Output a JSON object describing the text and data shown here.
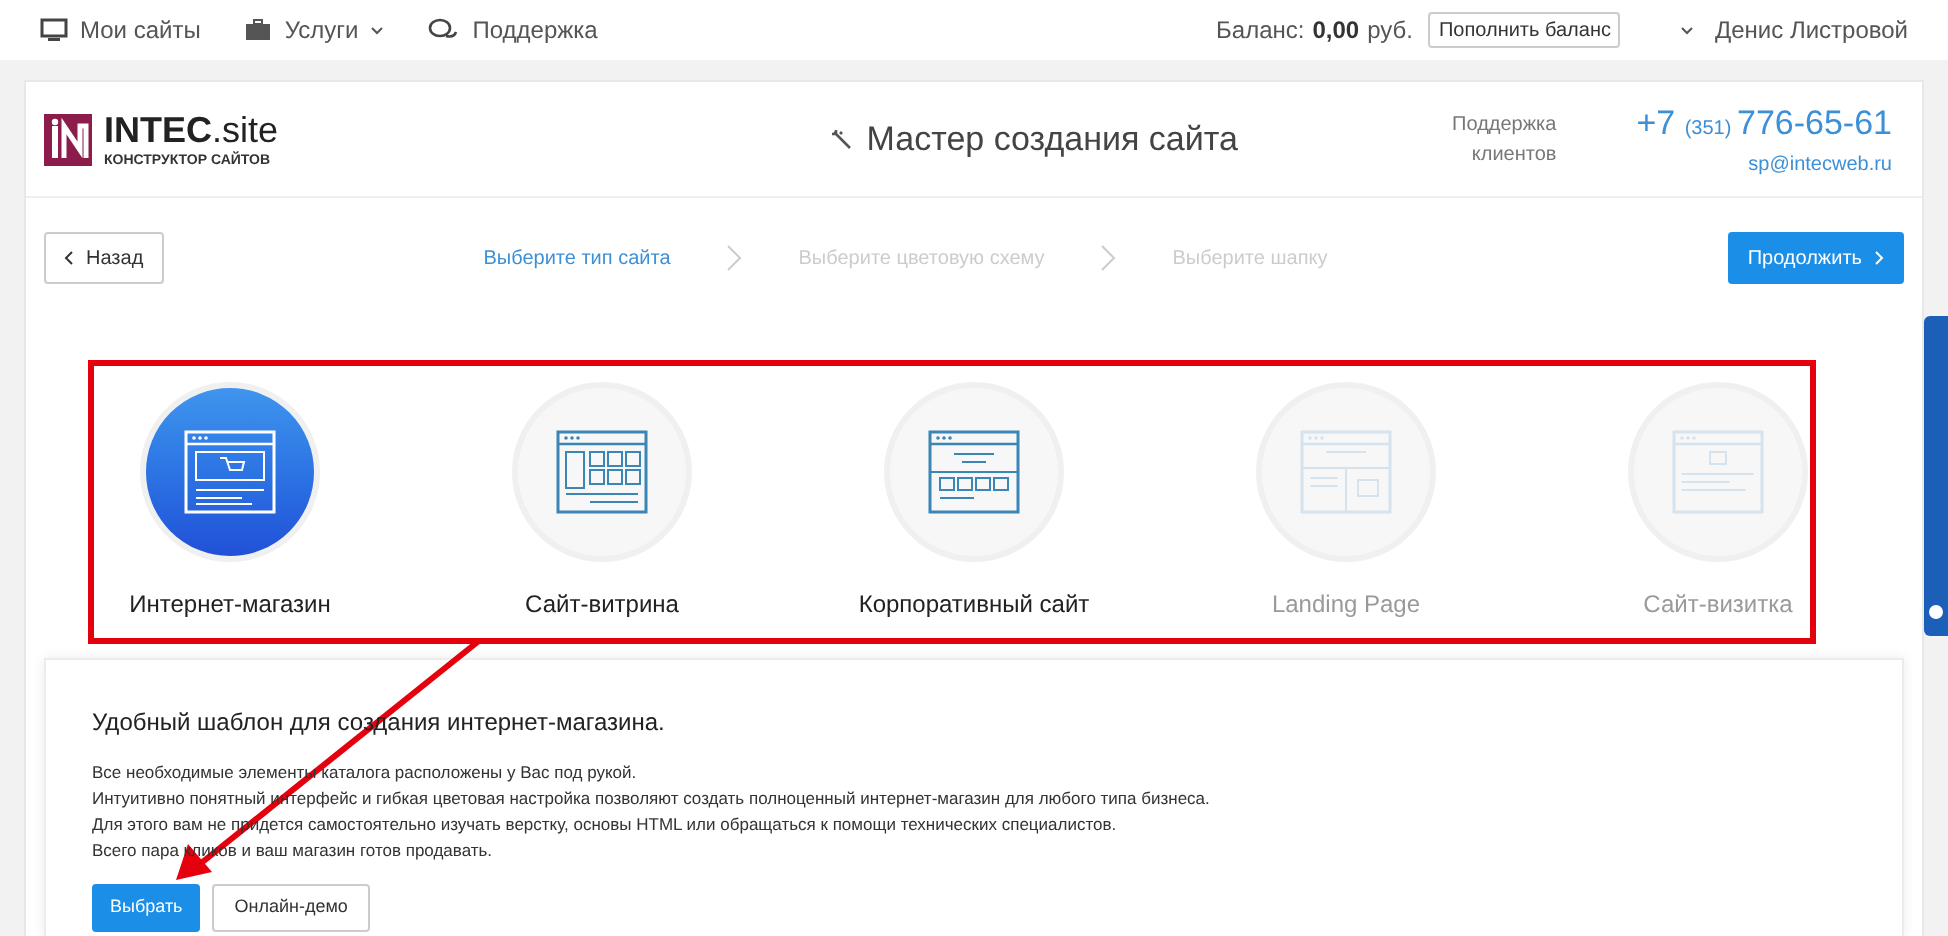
{
  "top_bar": {
    "nav": [
      {
        "label": "Мои сайты",
        "kind": "monitor"
      },
      {
        "label": "Услуги",
        "kind": "case",
        "dropdown": true
      },
      {
        "label": "Поддержка",
        "kind": "chat"
      }
    ],
    "balance_label": "Баланс:",
    "balance_value": "0,00",
    "balance_currency": "руб.",
    "top_up_button": "Пополнить баланс",
    "user": "Денис Листровой"
  },
  "header": {
    "logo_name": "INTEC",
    "logo_suffix": ".site",
    "logo_tagline": "КОНСТРУКТОР САЙТОВ",
    "title": "Мастер создания сайта",
    "support_label": "Поддержка клиентов",
    "phone_prefix": "+7",
    "phone_code": "(351)",
    "phone_number": "776-65-61",
    "email": "sp@intecweb.ru"
  },
  "wizard": {
    "back_button": "Назад",
    "next_button": "Продолжить",
    "steps": [
      {
        "label": "Выберите тип сайта",
        "selected": true
      },
      {
        "label": "Выберите цветовую схему",
        "selected": false
      },
      {
        "label": "Выберите шапку",
        "selected": false
      }
    ]
  },
  "site_types": [
    {
      "label": "Интернет-магазин",
      "kind": "shop",
      "selected": true,
      "disabled": false
    },
    {
      "label": "Сайт-витрина",
      "kind": "showcase",
      "selected": false,
      "disabled": false
    },
    {
      "label": "Корпоративный сайт",
      "kind": "corporate",
      "selected": false,
      "disabled": false
    },
    {
      "label": "Landing Page",
      "kind": "landing",
      "selected": false,
      "disabled": true
    },
    {
      "label": "Сайт-визитка",
      "kind": "card",
      "selected": false,
      "disabled": true
    }
  ],
  "description": {
    "title": "Удобный шаблон для создания интернет-магазина.",
    "lines": [
      "Все необходимые элементы каталога расположены у Вас под рукой.",
      "Интуитивно понятный интерфейс и гибкая цветовая настройка позволяют создать полноценный интернет-магазин для любого типа бизнеса.",
      "Для этого вам не придется самостоятельно изучать верстку, основы HTML или обращаться к помощи технических специалистов.",
      "Всего пара кликов и ваш магазин готов продавать."
    ],
    "select_button": "Выбрать",
    "demo_button": "Онлайн-демо"
  }
}
